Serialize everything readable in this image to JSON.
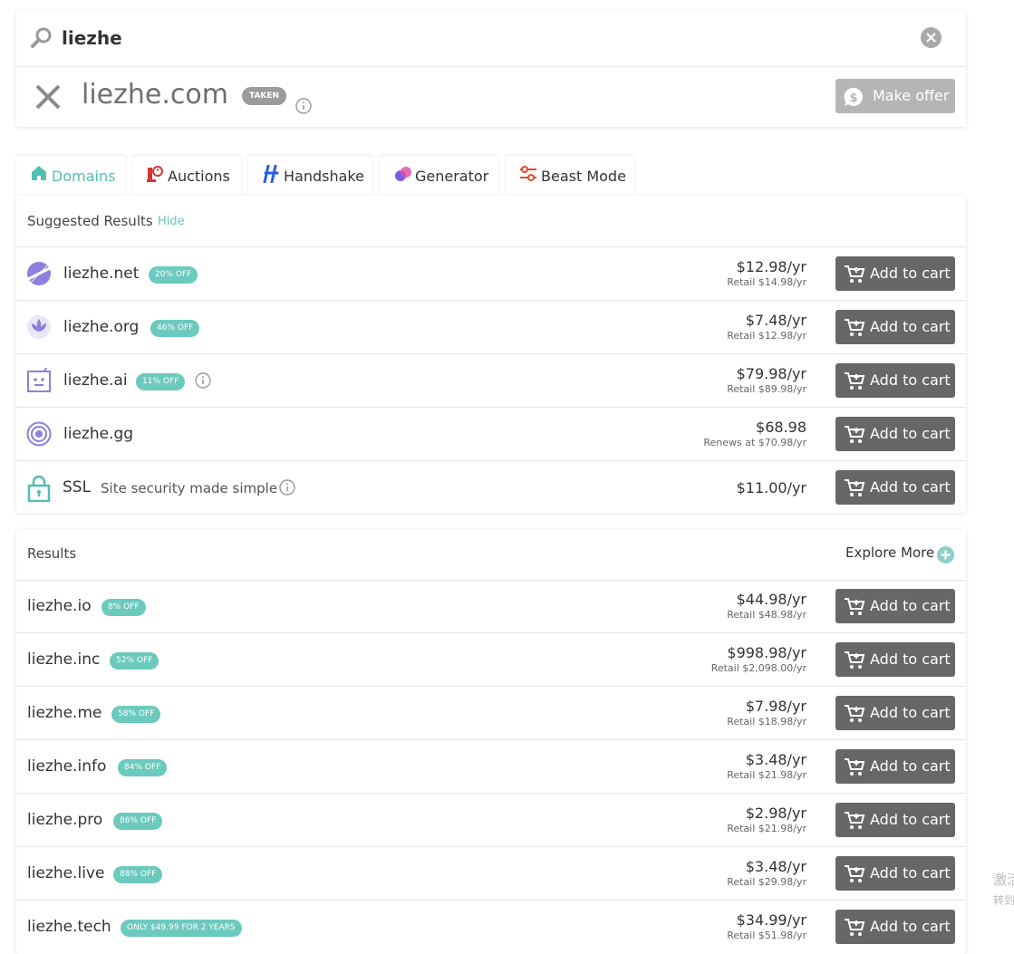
{
  "search": {
    "query": "liezhe"
  },
  "taken": {
    "domain": "liezhe.com",
    "badge": "TAKEN",
    "offer_label": "Make offer"
  },
  "tabs": [
    {
      "label": "Domains",
      "icon": "home-icon",
      "active": true
    },
    {
      "label": "Auctions",
      "icon": "auction-icon"
    },
    {
      "label": "Handshake",
      "icon": "handshake-icon"
    },
    {
      "label": "Generator",
      "icon": "generator-icon"
    },
    {
      "label": "Beast Mode",
      "icon": "sliders-icon"
    }
  ],
  "suggested": {
    "title": "Suggested Results",
    "hide_label": "Hide",
    "rows": [
      {
        "name": "liezhe.net",
        "badge": "20% OFF",
        "price": "$12.98/yr",
        "retail": "Retail $14.98/yr",
        "icon": "net-planet-icon"
      },
      {
        "name": "liezhe.org",
        "badge": "46% OFF",
        "price": "$7.48/yr",
        "retail": "Retail $12.98/yr",
        "icon": "org-lotus-icon"
      },
      {
        "name": "liezhe.ai",
        "badge": "11% OFF",
        "price": "$79.98/yr",
        "retail": "Retail $89.98/yr",
        "icon": "ai-robot-icon"
      },
      {
        "name": "liezhe.gg",
        "badge": "",
        "price": "$68.98",
        "retail": "Renews at $70.98/yr",
        "icon": "gg-target-icon"
      },
      {
        "name": "SSL",
        "desc": "Site security made simple",
        "price": "$11.00/yr",
        "retail": "",
        "icon": "lock-icon"
      }
    ]
  },
  "results": {
    "title": "Results",
    "explore_label": "Explore More",
    "rows": [
      {
        "name": "liezhe.io",
        "badge": "8% OFF",
        "price": "$44.98/yr",
        "retail": "Retail $48.98/yr"
      },
      {
        "name": "liezhe.inc",
        "badge": "52% OFF",
        "price": "$998.98/yr",
        "retail": "Retail $2,098.00/yr"
      },
      {
        "name": "liezhe.me",
        "badge": "58% OFF",
        "price": "$7.98/yr",
        "retail": "Retail $18.98/yr"
      },
      {
        "name": "liezhe.info",
        "badge": "84% OFF",
        "price": "$3.48/yr",
        "retail": "Retail $21.98/yr"
      },
      {
        "name": "liezhe.pro",
        "badge": "86% OFF",
        "price": "$2.98/yr",
        "retail": "Retail $21.98/yr"
      },
      {
        "name": "liezhe.live",
        "badge": "88% OFF",
        "price": "$3.48/yr",
        "retail": "Retail $29.98/yr"
      },
      {
        "name": "liezhe.tech",
        "badge": "ONLY $49.99 FOR 2 YEARS",
        "price": "$34.99/yr",
        "retail": "Retail $51.98/yr"
      }
    ]
  },
  "cart_label": "Add to cart",
  "side_text": {
    "line1": "激活",
    "line2": "转到"
  },
  "colors": {
    "accent": "#52bfb0",
    "badge": "#6cc9bd",
    "button": "#676767",
    "offer_button": "#b5b5b5"
  }
}
